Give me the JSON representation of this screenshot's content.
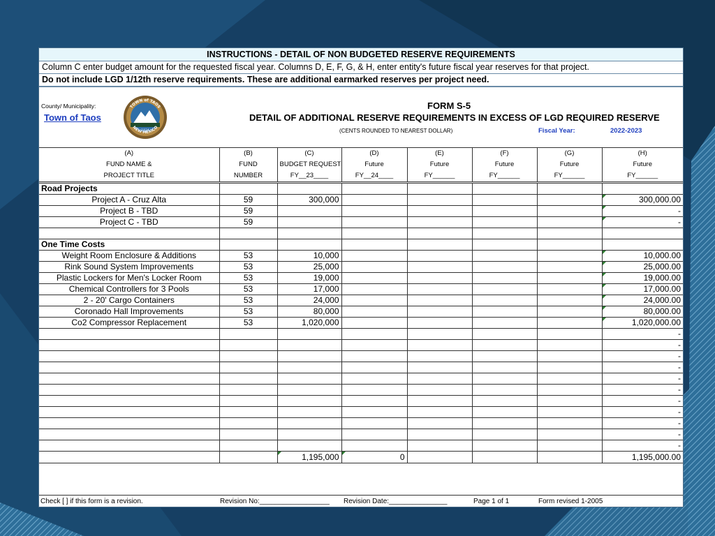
{
  "instructions": {
    "title": "INSTRUCTIONS - DETAIL OF NON BUDGETED RESERVE REQUIREMENTS",
    "line1": "Column C enter budget amount for the requested fiscal year.  Columns D, E, F, G, & H, enter entity's future fiscal year reserves for that project.",
    "line2": "Do not include LGD  1/12th reserve requirements.  These are additional earmarked reserves per project need."
  },
  "header": {
    "county_label": "County/ Municipality:",
    "town": " Town of Taos ",
    "form_id": "FORM  S-5",
    "form_title": "DETAIL OF ADDITIONAL RESERVE REQUIREMENTS IN EXCESS OF LGD REQUIRED RESERVE",
    "cents_note": "(CENTS ROUNDED TO NEAREST DOLLAR)",
    "fiscal_year_label": "Fiscal Year:",
    "fiscal_year_value": "2022-2023",
    "seal": {
      "top_text": "TOWN of TAOS",
      "bottom_text": "NEW MEXICO",
      "year": "1934"
    }
  },
  "columns": [
    {
      "letter": "(A)",
      "line2": "FUND NAME &",
      "line3": "PROJECT TITLE"
    },
    {
      "letter": "(B)",
      "line2": "FUND",
      "line3": "NUMBER"
    },
    {
      "letter": "(C)",
      "line2": "BUDGET REQUEST",
      "line3": "FY__23____"
    },
    {
      "letter": "(D)",
      "line2": "Future",
      "line3": "FY__24____"
    },
    {
      "letter": "(E)",
      "line2": "Future",
      "line3": "FY______"
    },
    {
      "letter": "(F)",
      "line2": "Future",
      "line3": "FY______"
    },
    {
      "letter": "(G)",
      "line2": "Future",
      "line3": "FY______"
    },
    {
      "letter": "(H)",
      "line2": "Future",
      "line3": "FY______"
    }
  ],
  "rows": [
    {
      "type": "section",
      "name": "Road Projects",
      "fund": "",
      "c": "",
      "h": "",
      "tri": false
    },
    {
      "type": "item",
      "name": "Project A - Cruz Alta",
      "fund": "59",
      "c": "300,000",
      "h": "300,000.00",
      "tri": true
    },
    {
      "type": "item",
      "name": "Project B - TBD",
      "fund": "59",
      "c": "",
      "h": "-",
      "tri": true
    },
    {
      "type": "item",
      "name": "Project C - TBD",
      "fund": "59",
      "c": "",
      "h": "-",
      "tri": true
    },
    {
      "type": "blank",
      "name": "",
      "fund": "",
      "c": "",
      "h": "",
      "tri": false
    },
    {
      "type": "section",
      "name": "One Time Costs",
      "fund": "",
      "c": "",
      "h": "",
      "tri": false
    },
    {
      "type": "item",
      "name": "Weight Room Enclosure & Additions",
      "fund": "53",
      "c": "10,000",
      "h": "10,000.00",
      "tri": true
    },
    {
      "type": "item",
      "name": "Rink Sound System Improvements",
      "fund": "53",
      "c": "25,000",
      "h": "25,000.00",
      "tri": true
    },
    {
      "type": "item",
      "name": "Plastic Lockers for Men's Locker Room",
      "fund": "53",
      "c": "19,000",
      "h": "19,000.00",
      "tri": true
    },
    {
      "type": "item",
      "name": "Chemical Controllers for 3 Pools",
      "fund": "53",
      "c": "17,000",
      "h": "17,000.00",
      "tri": true
    },
    {
      "type": "item",
      "name": "2 - 20' Cargo Containers",
      "fund": "53",
      "c": "24,000",
      "h": "24,000.00",
      "tri": true
    },
    {
      "type": "item",
      "name": "Coronado Hall Improvements",
      "fund": "53",
      "c": "80,000",
      "h": "80,000.00",
      "tri": true
    },
    {
      "type": "item",
      "name": "Co2 Compressor Replacement",
      "fund": "53",
      "c": "1,020,000",
      "h": "1,020,000.00",
      "tri": true
    },
    {
      "type": "empty",
      "name": "",
      "fund": "",
      "c": "",
      "h": "-",
      "tri": false
    },
    {
      "type": "empty",
      "name": "",
      "fund": "",
      "c": "",
      "h": "-",
      "tri": false
    },
    {
      "type": "empty",
      "name": "",
      "fund": "",
      "c": "",
      "h": "-",
      "tri": false
    },
    {
      "type": "empty",
      "name": "",
      "fund": "",
      "c": "",
      "h": "-",
      "tri": false
    },
    {
      "type": "empty",
      "name": "",
      "fund": "",
      "c": "",
      "h": "-",
      "tri": false
    },
    {
      "type": "empty",
      "name": "",
      "fund": "",
      "c": "",
      "h": "-",
      "tri": false
    },
    {
      "type": "empty",
      "name": "",
      "fund": "",
      "c": "",
      "h": "-",
      "tri": false
    },
    {
      "type": "empty",
      "name": "",
      "fund": "",
      "c": "",
      "h": "-",
      "tri": false
    },
    {
      "type": "empty",
      "name": "",
      "fund": "",
      "c": "",
      "h": "-",
      "tri": false
    },
    {
      "type": "empty",
      "name": "",
      "fund": "",
      "c": "",
      "h": "-",
      "tri": false
    },
    {
      "type": "empty",
      "name": "",
      "fund": "",
      "c": "",
      "h": "-",
      "tri": false
    }
  ],
  "totals": {
    "c": "1,195,000",
    "d": "0",
    "h": "1,195,000.00"
  },
  "footer": {
    "check": "Check   [   ]   if  this  form  is  a  revision.",
    "revision_no": "Revision No:__________________",
    "revision_date": "Revision Date:_______________",
    "page": "Page 1 of 1",
    "form_revised": "Form revised 1-2005"
  }
}
